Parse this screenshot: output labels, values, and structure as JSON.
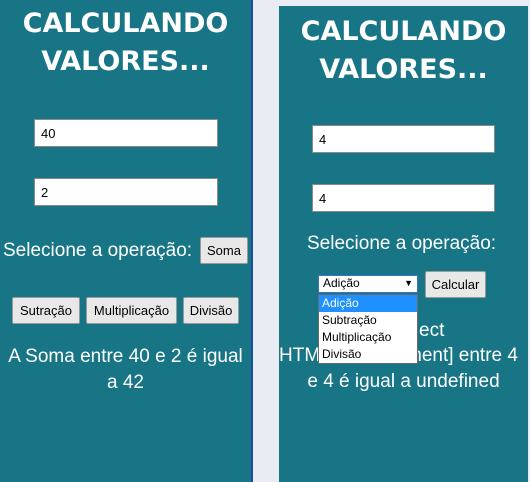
{
  "left": {
    "title_line1": "CALCULANDO",
    "title_line2": "VALORES...",
    "input1_value": "40",
    "input2_value": "2",
    "operation_label": "Selecione a operação:",
    "soma_button": "Soma",
    "subtracao_button": "Sutração",
    "multiplicacao_button": "Multiplicação",
    "divisao_button": "Divisão",
    "result_line1": "A Soma entre 40 e 2 é igual",
    "result_line2": "a 42"
  },
  "right": {
    "title_line1": "CALCULANDO",
    "title_line2": "VALORES...",
    "input1_value": "4",
    "input2_value": "4",
    "operation_label": "Selecione a operação:",
    "select_value": "Adição",
    "calcular_button": "Calcular",
    "options": [
      "Adição",
      "Subtração",
      "Multiplicação",
      "Divisão"
    ],
    "behind_line1": "ect",
    "behind_line2_left": "HTM",
    "behind_line2_right": "ment] entre 4",
    "behind_line3": "e 4 é igual a undefined"
  }
}
